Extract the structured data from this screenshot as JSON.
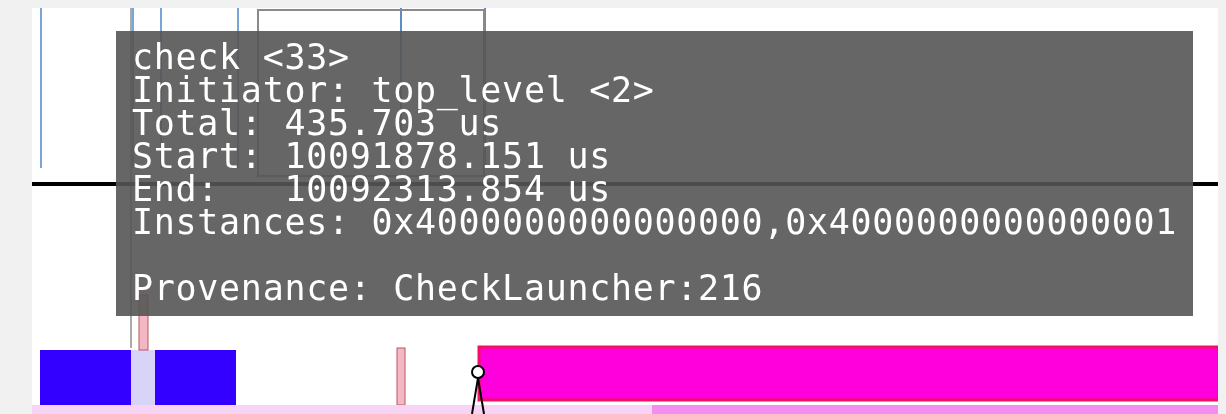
{
  "tooltip": {
    "lines": [
      "check <33>",
      "Initiator: top_level <2>",
      "Total: 435.703 us",
      "Start: 10091878.151 us",
      "End:   10092313.854 us",
      "Instances: 0x4000000000000000,0x4000000000000001"
    ],
    "footer": "Provenance: CheckLauncher:216"
  }
}
